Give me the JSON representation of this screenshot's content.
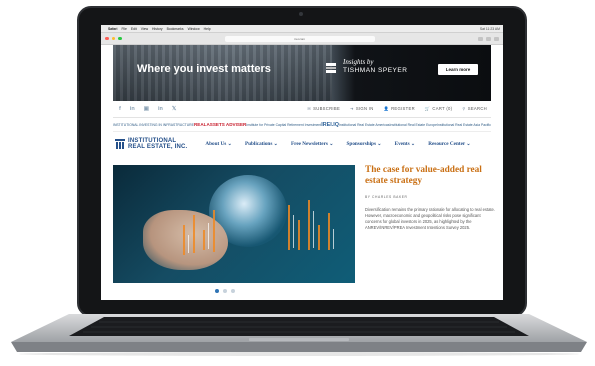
{
  "menubar": {
    "apple": "",
    "items": [
      "Safari",
      "File",
      "Edit",
      "View",
      "History",
      "Bookmarks",
      "Window",
      "Help"
    ],
    "status": "Sat 11:23 AM"
  },
  "browser": {
    "url": "irei.com"
  },
  "ad": {
    "headline": "Where you invest matters",
    "brand_line1": "Insights by",
    "brand_line2": "TISHMAN SPEYER",
    "button": "Learn more"
  },
  "social": [
    "f",
    "in",
    "▣",
    "in",
    "𝕏"
  ],
  "utility_nav": [
    {
      "icon": "✉",
      "label": "SUBSCRIBE"
    },
    {
      "icon": "➜",
      "label": "SIGN IN"
    },
    {
      "icon": "👤",
      "label": "REGISTER"
    },
    {
      "icon": "🛒",
      "label": "CART (0)"
    },
    {
      "icon": "⚲",
      "label": "SEARCH"
    }
  ],
  "publications": [
    {
      "label": "INSTITUTIONAL INVESTING IN INFRASTRUCTURE",
      "style": "plain"
    },
    {
      "label": "REALASSETS ADVISER",
      "style": "red"
    },
    {
      "label": "Institute for Private Capital Retirement Investment",
      "style": "plain"
    },
    {
      "label": "IREI.IQ",
      "style": "ire"
    },
    {
      "label": "Institutional Real Estate Americas",
      "style": "plain"
    },
    {
      "label": "Institutional Real Estate Europe",
      "style": "plain"
    },
    {
      "label": "Institutional Real Estate Asia Pacific",
      "style": "plain"
    }
  ],
  "logo": {
    "line1": "INSTITUTIONAL",
    "line2": "REAL ESTATE, INC."
  },
  "nav": [
    "About Us ⌄",
    "Publications ⌄",
    "Free Newsletters ⌄",
    "Sponsorships ⌄",
    "Events ⌄",
    "Resource Center ⌄"
  ],
  "article": {
    "title": "The case for value-added real estate strategy",
    "byline": "BY CHARLES BAKER",
    "excerpt": "Diversification remains the primary rationale for allocating to real estate. However, macroeconomic and geopolitical risks pose significant concerns for global investors in 2025, as highlighted by the ANREV/INREV/PREA Investment Intentions Survey 2025."
  },
  "carousel": {
    "total": 3,
    "active": 1
  },
  "colors": {
    "brand_blue": "#25508a",
    "headline_orange": "#c96f13",
    "active_dot": "#2f74b5"
  }
}
